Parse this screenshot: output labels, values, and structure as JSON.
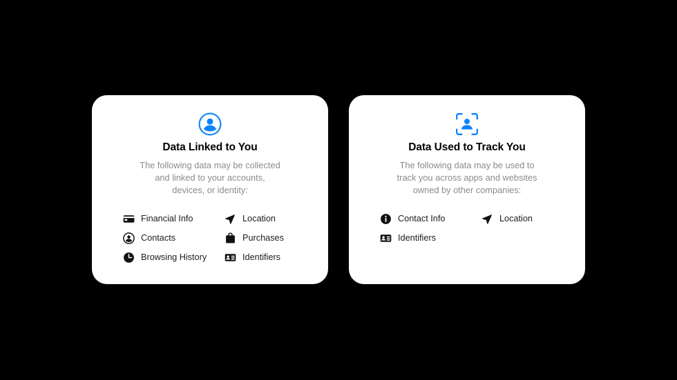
{
  "page": {
    "background_color": "#000000",
    "card_background_color": "#ffffff",
    "accent_color": "#0a84ff",
    "title_color": "#000000",
    "description_color": "#8b8b90",
    "label_color": "#1c1c1e"
  },
  "cards": [
    {
      "id": "data-linked-to-you",
      "header_icon": "person-circle-icon",
      "title": "Data Linked to You",
      "description": "The following data may be collected\nand linked to your accounts,\ndevices, or identity:",
      "categories": [
        {
          "label": "Financial Info",
          "icon": "credit-card-icon"
        },
        {
          "label": "Location",
          "icon": "location-arrow-icon"
        },
        {
          "label": "Contacts",
          "icon": "contacts-person-circle-icon"
        },
        {
          "label": "Purchases",
          "icon": "shopping-bag-icon"
        },
        {
          "label": "Browsing History",
          "icon": "clock-icon"
        },
        {
          "label": "Identifiers",
          "icon": "id-card-icon"
        }
      ]
    },
    {
      "id": "data-used-to-track-you",
      "header_icon": "person-viewfinder-icon",
      "title": "Data Used to Track You",
      "description": "The following data may be used to\ntrack you across apps and websites\nowned by other companies:",
      "categories": [
        {
          "label": "Contact Info",
          "icon": "info-circle-icon"
        },
        {
          "label": "Location",
          "icon": "location-arrow-icon"
        },
        {
          "label": "Identifiers",
          "icon": "id-card-icon"
        }
      ]
    }
  ]
}
